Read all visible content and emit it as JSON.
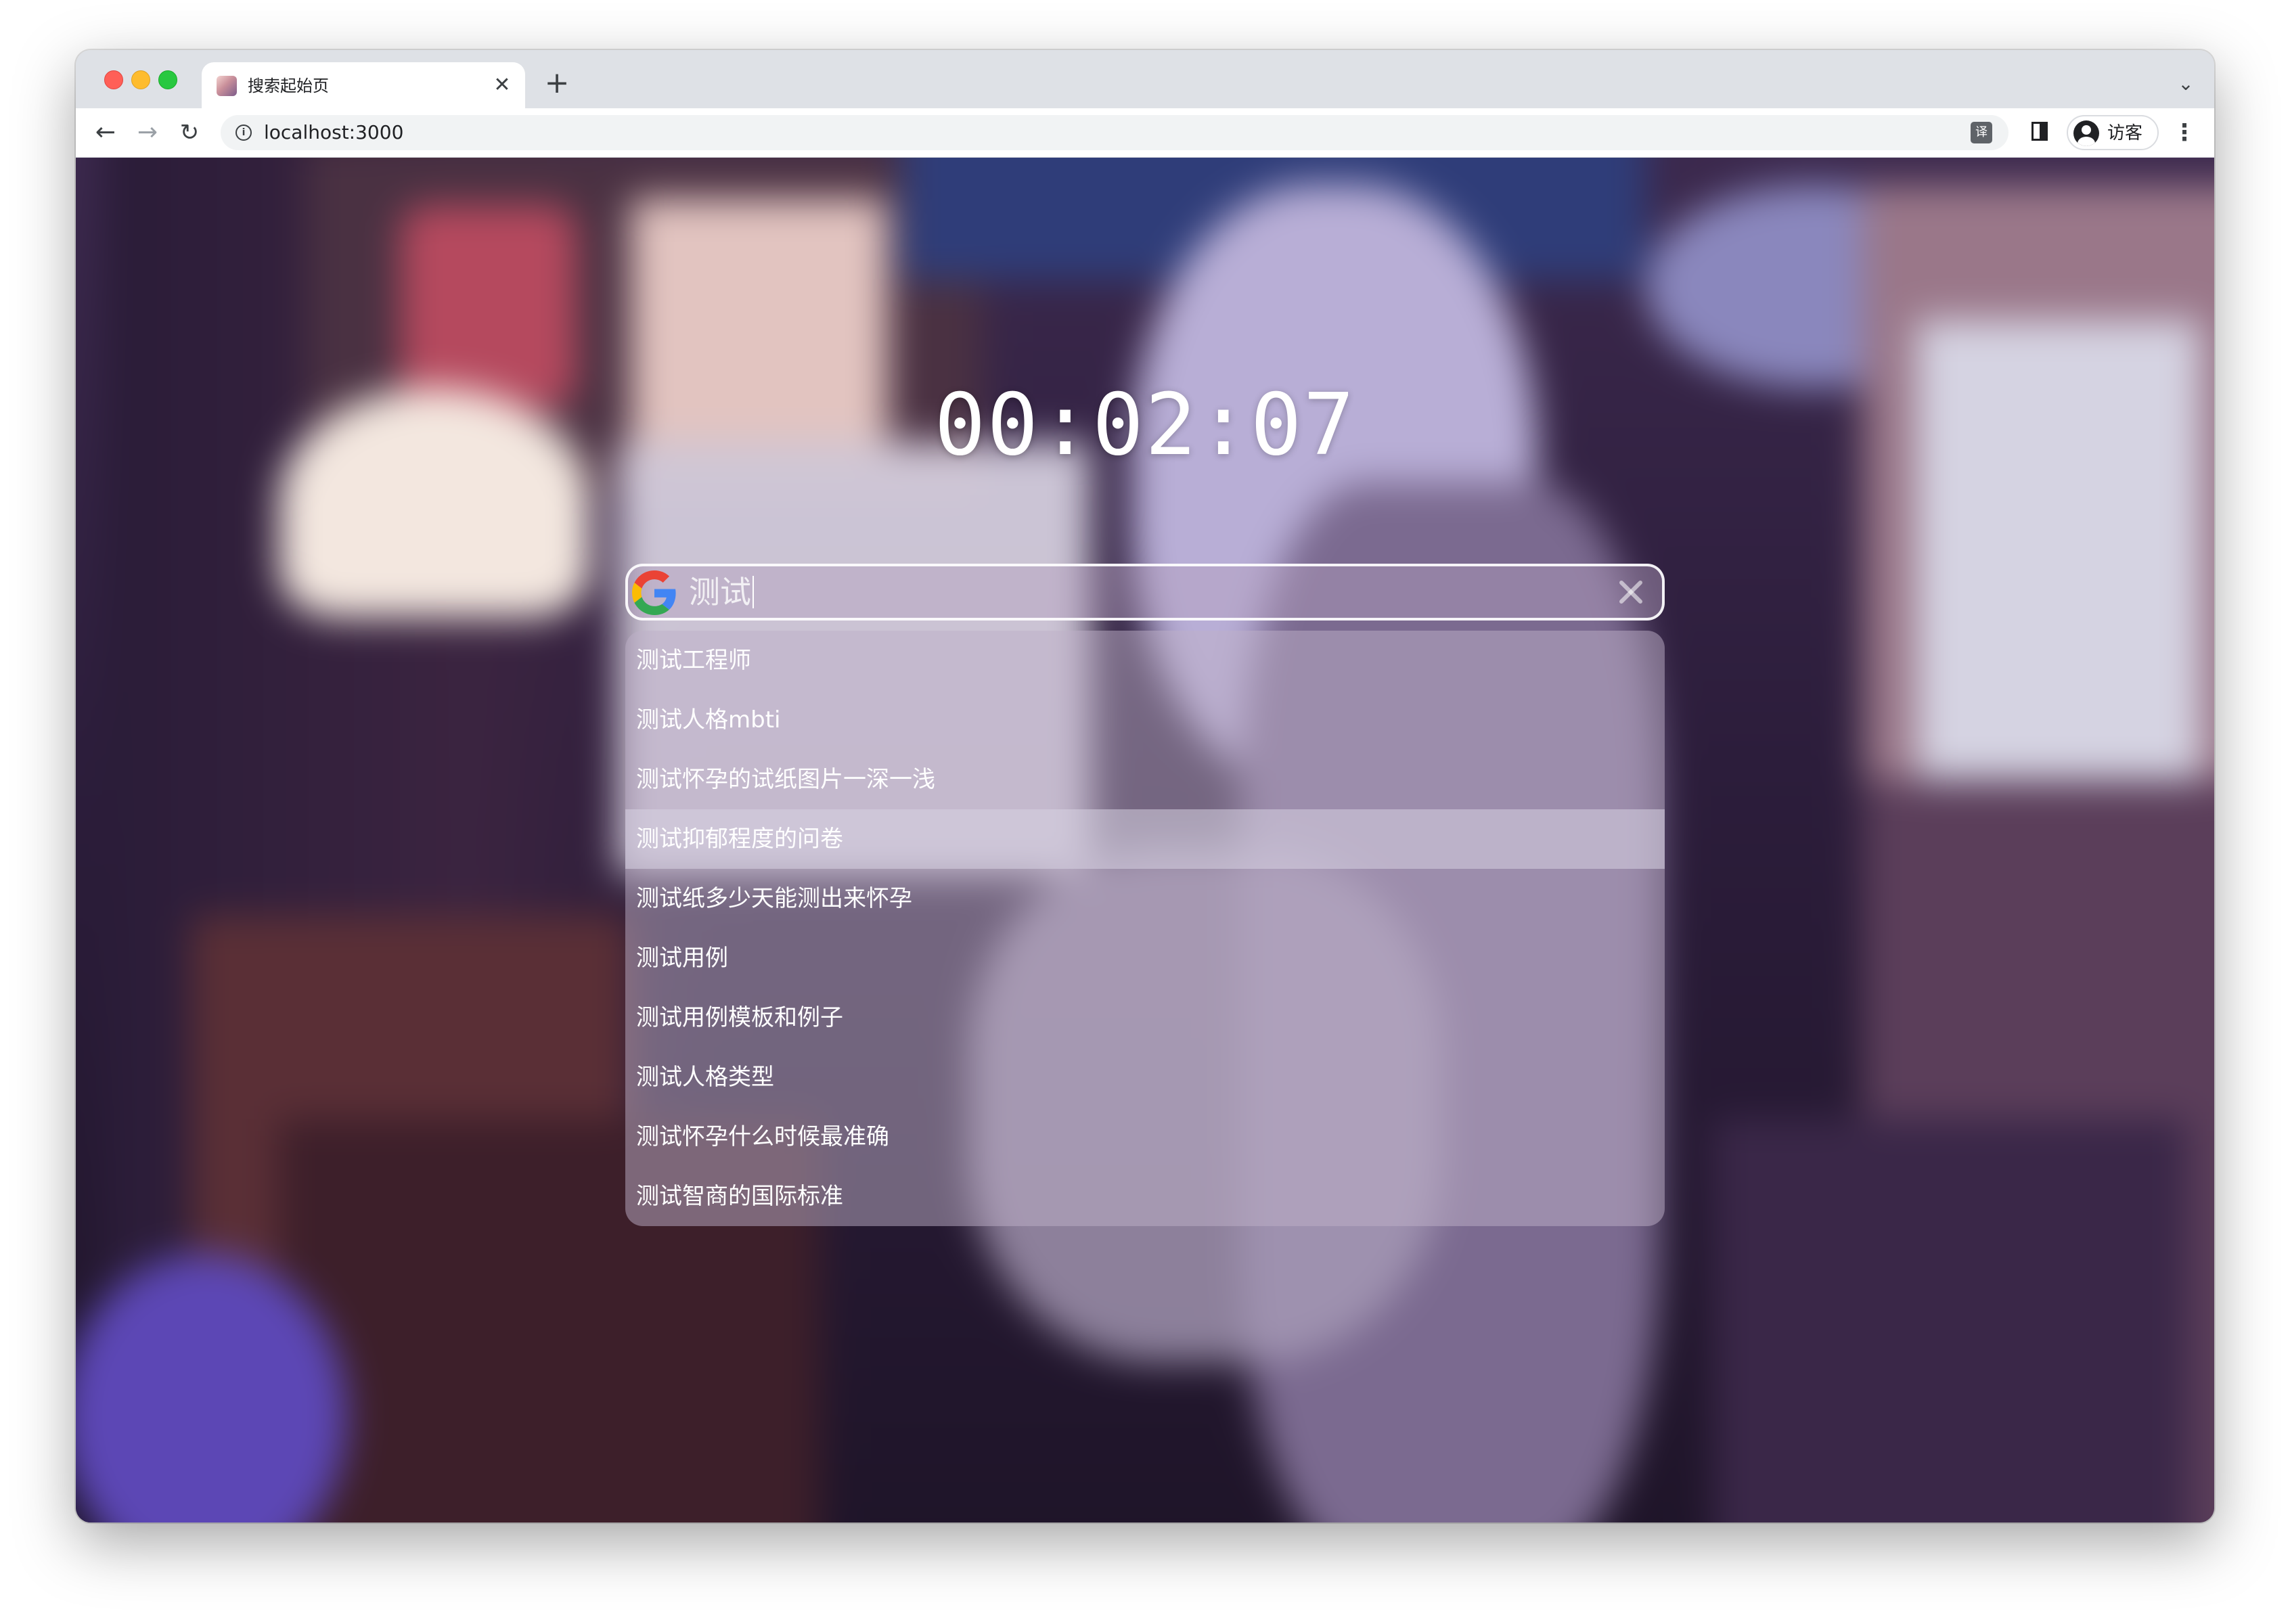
{
  "browser": {
    "tab_title": "搜索起始页",
    "tab_close": "✕",
    "new_tab": "+",
    "tab_search": "⌄",
    "url": "localhost:3000",
    "back": "←",
    "forward": "→",
    "reload": "↻",
    "translate": "译",
    "profile_label": "访客",
    "menu": "⋮"
  },
  "page": {
    "clock": "00:02:07",
    "search": {
      "engine_icon": "google-icon",
      "value": "测试",
      "clear_icon": "close-icon"
    },
    "suggestions": [
      {
        "text": "测试工程师"
      },
      {
        "text": "测试人格mbti"
      },
      {
        "text": "测试怀孕的试纸图片一深一浅"
      },
      {
        "text": "测试抑郁程度的问卷"
      },
      {
        "text": "测试纸多少天能测出来怀孕"
      },
      {
        "text": "测试用例"
      },
      {
        "text": "测试用例模板和例子"
      },
      {
        "text": "测试人格类型"
      },
      {
        "text": "测试怀孕什么时候最准确"
      },
      {
        "text": "测试智商的国际标准"
      }
    ],
    "active_suggestion_index": 3
  },
  "colors": {
    "close": "#ff5f57",
    "minimize": "#febc2e",
    "maximize": "#28c840",
    "accent": "#ffffff"
  }
}
